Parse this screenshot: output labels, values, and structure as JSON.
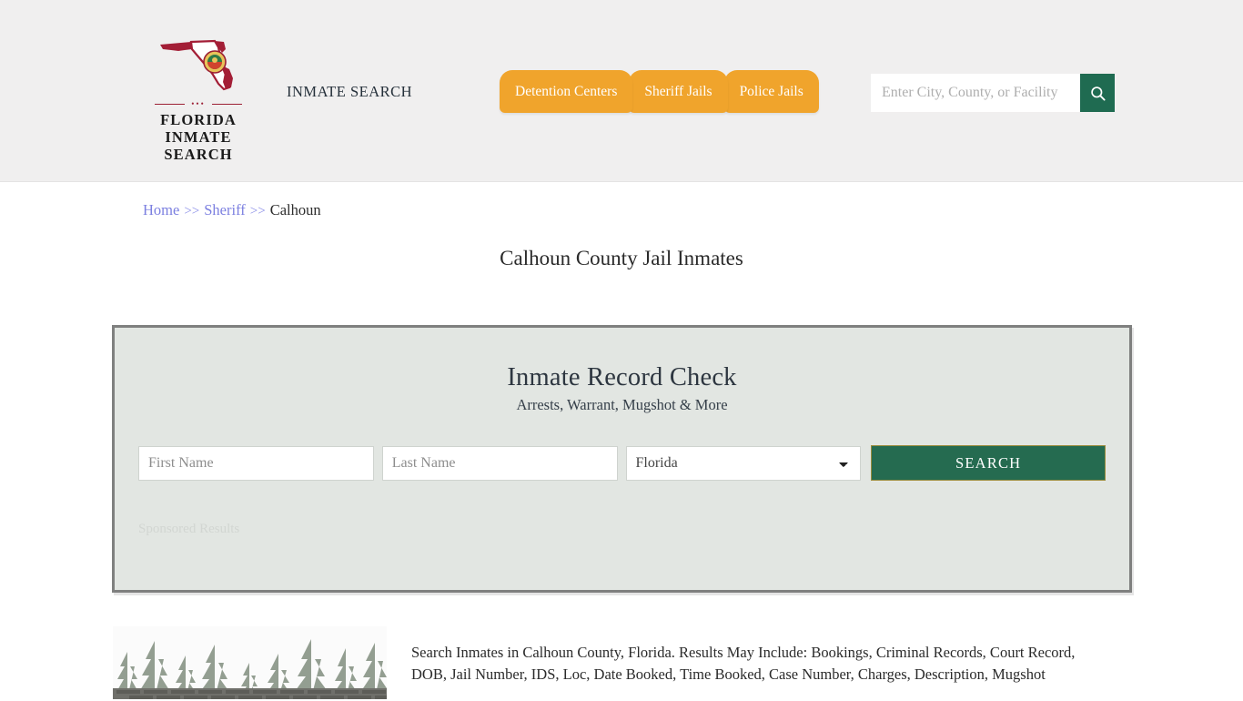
{
  "header": {
    "logo": {
      "icon": "florida-map-icon",
      "line1": "FLORIDA",
      "line2": "INMATE SEARCH",
      "dots": "•••"
    },
    "tagline": "INMATE SEARCH",
    "nav": [
      {
        "label": "Detention Centers"
      },
      {
        "label": "Sheriff Jails"
      },
      {
        "label": "Police Jails"
      }
    ],
    "search": {
      "placeholder": "Enter City, County, or Facility",
      "value": "",
      "icon": "search-icon"
    },
    "bg_color": "#f0efef",
    "nav_color": "#f0a42c",
    "search_btn_color": "#1f6b51"
  },
  "breadcrumb": {
    "home": "Home",
    "sep1": ">>",
    "sheriff": "Sheriff",
    "sep2": ">>",
    "current": "Calhoun",
    "link_color": "#7b7fe0"
  },
  "page": {
    "title": "Calhoun County Jail Inmates"
  },
  "card": {
    "title": "Inmate Record Check",
    "subtitle": "Arrests, Warrant, Mugshot & More",
    "first_name_placeholder": "First Name",
    "first_name_value": "",
    "last_name_placeholder": "Last Name",
    "last_name_value": "",
    "state_selected": "Florida",
    "state_options": [
      "Florida"
    ],
    "search_label": "SEARCH",
    "sponsored_label": "Sponsored Results",
    "bg_color": "#e2e6e2",
    "border_color": "#7f807f",
    "button_color": "#256b50",
    "button_border_color": "#9a8c3c"
  },
  "bottom": {
    "image_alt": "calhoun-county-jail-photo",
    "description": "Search Inmates in Calhoun County, Florida. Results May Include: Bookings, Criminal Records, Court Record, DOB, Jail Number, IDS, Loc, Date Booked, Time Booked, Case Number, Charges, Description, Mugshot"
  }
}
